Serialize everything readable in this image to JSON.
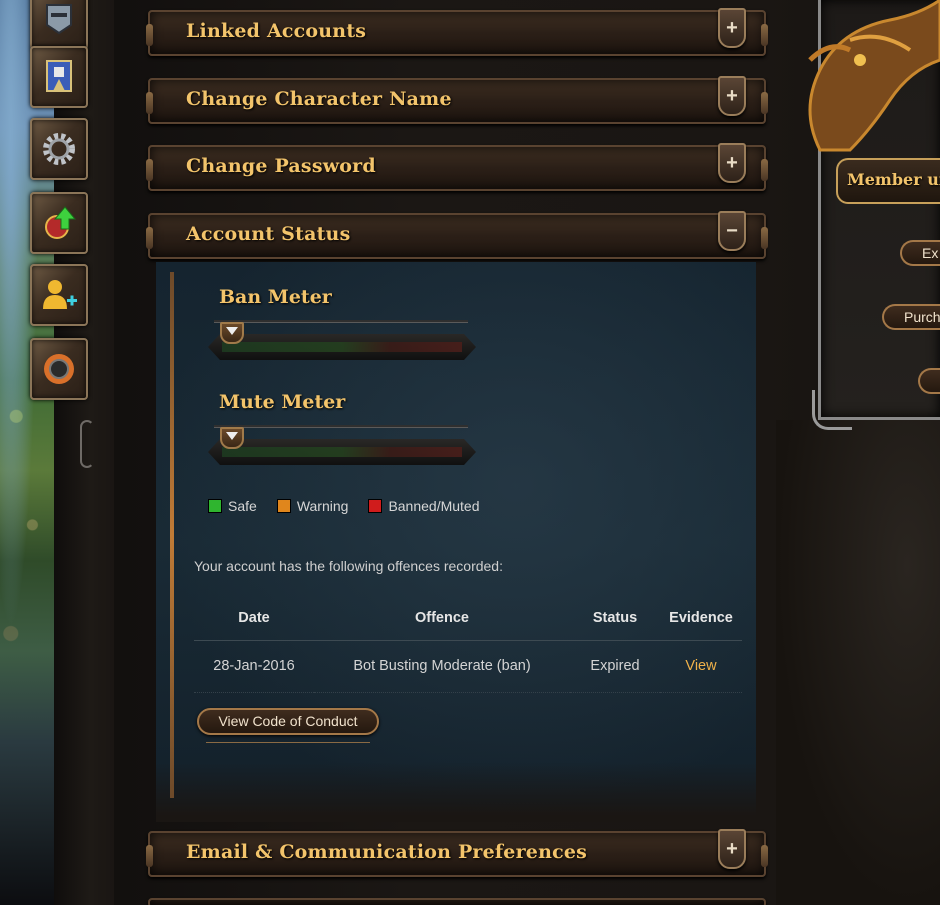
{
  "sections": {
    "linked_accounts": "Linked Accounts",
    "change_character_name": "Change Character Name",
    "change_password": "Change Password",
    "account_status": "Account Status",
    "email_prefs": "Email & Communication Preferences"
  },
  "toggles": {
    "plus": "+",
    "minus": "−"
  },
  "account_status": {
    "ban_meter_title": "Ban Meter",
    "mute_meter_title": "Mute Meter",
    "ban_meter_level": 0.0,
    "mute_meter_level": 0.0,
    "legend": [
      {
        "label": "Safe",
        "color": "#2fb52f"
      },
      {
        "label": "Warning",
        "color": "#e0861c"
      },
      {
        "label": "Banned/Muted",
        "color": "#d01c1c"
      }
    ],
    "offences_intro": "Your account has the following offences recorded:",
    "table": {
      "headers": [
        "Date",
        "Offence",
        "Status",
        "Evidence"
      ],
      "rows": [
        [
          "28-Jan-2016",
          "Bot Busting Moderate (ban)",
          "Expired",
          "View"
        ]
      ]
    },
    "code_of_conduct_button": "View Code of Conduct"
  },
  "member_panel": {
    "label": "Member un",
    "buttons": [
      "Ex",
      "Purch",
      ""
    ]
  },
  "sidebar_icons": [
    "helmet-icon",
    "banner-icon",
    "gear-icon",
    "upgrade-icon",
    "add-friend-icon",
    "bomb-icon"
  ]
}
